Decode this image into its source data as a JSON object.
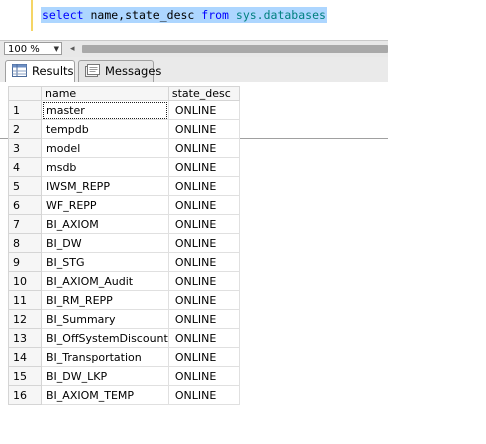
{
  "editor": {
    "query_tokens": [
      {
        "text": "select",
        "kind": "kw"
      },
      {
        "text": " name",
        "kind": "id"
      },
      {
        "text": ",",
        "kind": "id"
      },
      {
        "text": "state_desc",
        "kind": "id"
      },
      {
        "text": " from ",
        "kind": "kw"
      },
      {
        "text": "sys.databases",
        "kind": "ob"
      }
    ]
  },
  "zoom": {
    "value": "100 %"
  },
  "tabs": {
    "results": "Results",
    "messages": "Messages"
  },
  "grid": {
    "columns": [
      "name",
      "state_desc"
    ],
    "rows": [
      {
        "n": "1",
        "name": "master",
        "state": "ONLINE"
      },
      {
        "n": "2",
        "name": "tempdb",
        "state": "ONLINE"
      },
      {
        "n": "3",
        "name": "model",
        "state": "ONLINE"
      },
      {
        "n": "4",
        "name": "msdb",
        "state": "ONLINE"
      },
      {
        "n": "5",
        "name": "IWSM_REPP",
        "state": "ONLINE"
      },
      {
        "n": "6",
        "name": "WF_REPP",
        "state": "ONLINE"
      },
      {
        "n": "7",
        "name": "BI_AXIOM",
        "state": "ONLINE"
      },
      {
        "n": "8",
        "name": "BI_DW",
        "state": "ONLINE"
      },
      {
        "n": "9",
        "name": "BI_STG",
        "state": "ONLINE"
      },
      {
        "n": "10",
        "name": "BI_AXIOM_Audit",
        "state": "ONLINE"
      },
      {
        "n": "11",
        "name": "BI_RM_REPP",
        "state": "ONLINE"
      },
      {
        "n": "12",
        "name": "BI_Summary",
        "state": "ONLINE"
      },
      {
        "n": "13",
        "name": "BI_OffSystemDiscount",
        "state": "ONLINE"
      },
      {
        "n": "14",
        "name": "BI_Transportation",
        "state": "ONLINE"
      },
      {
        "n": "15",
        "name": "BI_DW_LKP",
        "state": "ONLINE"
      },
      {
        "n": "16",
        "name": "BI_AXIOM_TEMP",
        "state": "ONLINE"
      }
    ]
  },
  "colors": {
    "keyword": "#0000ff",
    "object": "#008080",
    "selection": "#add6ff"
  }
}
